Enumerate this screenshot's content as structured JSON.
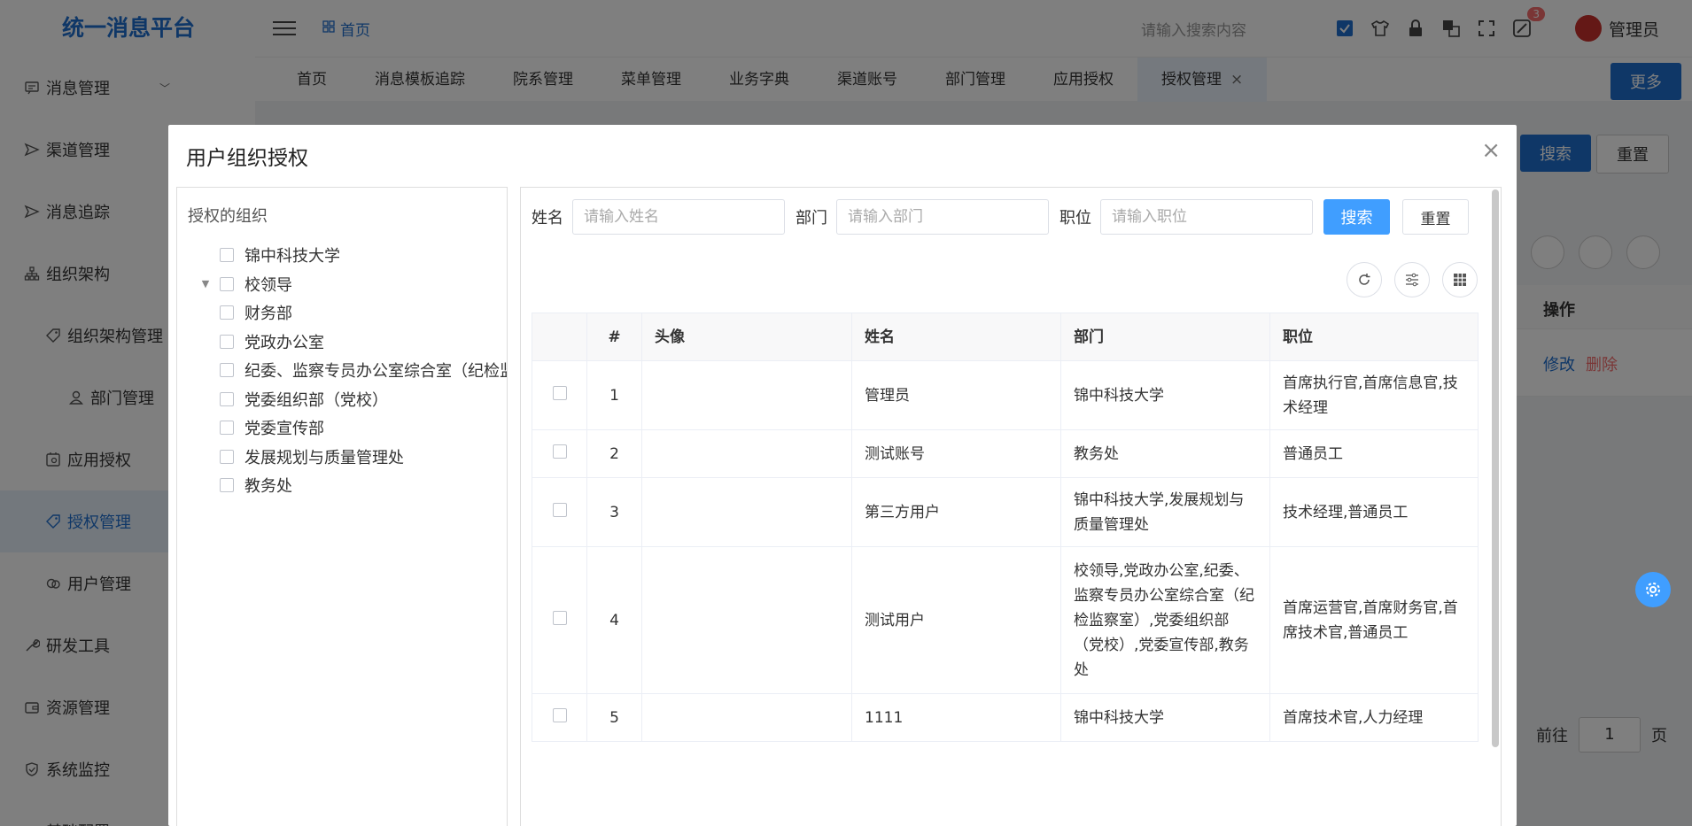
{
  "app": {
    "title": "统一消息平台"
  },
  "sidebar": {
    "items": [
      {
        "label": "消息管理",
        "icon": "message-icon",
        "level": 0,
        "arrow": true
      },
      {
        "label": "渠道管理",
        "icon": "send-icon",
        "level": 0
      },
      {
        "label": "消息追踪",
        "icon": "send-icon",
        "level": 0
      },
      {
        "label": "组织架构",
        "icon": "org-tree-icon",
        "level": 0
      },
      {
        "label": "组织架构管理",
        "icon": "tag-icon",
        "level": 1
      },
      {
        "label": "部门管理",
        "icon": "user-icon",
        "level": 2
      },
      {
        "label": "应用授权",
        "icon": "app-icon",
        "level": 1
      },
      {
        "label": "授权管理",
        "icon": "tag-icon",
        "level": 1,
        "active": true
      },
      {
        "label": "用户管理",
        "icon": "users-icon",
        "level": 1
      },
      {
        "label": "研发工具",
        "icon": "wrench-icon",
        "level": 0
      },
      {
        "label": "资源管理",
        "icon": "wallet-icon",
        "level": 0
      },
      {
        "label": "系统监控",
        "icon": "shield-icon",
        "level": 0
      },
      {
        "label": "基础配置",
        "icon": "users-icon",
        "level": 0
      }
    ]
  },
  "topbar": {
    "breadcrumb": "首页",
    "search_placeholder": "请输入搜索内容",
    "notification_count": "3",
    "user_name": "管理员"
  },
  "tabs": [
    {
      "label": "首页"
    },
    {
      "label": "消息模板追踪"
    },
    {
      "label": "院系管理"
    },
    {
      "label": "菜单管理"
    },
    {
      "label": "业务字典"
    },
    {
      "label": "渠道账号"
    },
    {
      "label": "部门管理"
    },
    {
      "label": "应用授权"
    },
    {
      "label": "授权管理",
      "active": true,
      "closable": true
    }
  ],
  "more_label": "更多",
  "background": {
    "search_label": "搜索",
    "reset_label": "重置",
    "ops_header": "操作",
    "edit_label": "修改",
    "delete_label": "删除",
    "goto_label": "前往",
    "page_value": "1",
    "page_suffix": "页"
  },
  "dialog": {
    "title": "用户组织授权",
    "org_panel_title": "授权的组织",
    "tree": [
      {
        "label": "锦中科技大学",
        "level": 0
      },
      {
        "label": "校领导",
        "level": 0,
        "expanded": true
      },
      {
        "label": "财务部",
        "level": 1
      },
      {
        "label": "党政办公室",
        "level": 0
      },
      {
        "label": "纪委、监察专员办公室综合室（纪检监察室）",
        "level": 0
      },
      {
        "label": "党委组织部（党校）",
        "level": 0
      },
      {
        "label": "党委宣传部",
        "level": 0
      },
      {
        "label": "发展规划与质量管理处",
        "level": 0
      },
      {
        "label": "教务处",
        "level": 0
      }
    ],
    "filter": {
      "name_label": "姓名",
      "name_placeholder": "请输入姓名",
      "dept_label": "部门",
      "dept_placeholder": "请输入部门",
      "position_label": "职位",
      "position_placeholder": "请输入职位",
      "search_label": "搜索",
      "reset_label": "重置"
    },
    "table": {
      "headers": {
        "index": "#",
        "avatar": "头像",
        "name": "姓名",
        "dept": "部门",
        "position": "职位"
      },
      "rows": [
        {
          "index": "1",
          "name": "管理员",
          "dept": "锦中科技大学",
          "position": "首席执行官,首席信息官,技术经理"
        },
        {
          "index": "2",
          "name": "测试账号",
          "dept": "教务处",
          "position": "普通员工"
        },
        {
          "index": "3",
          "name": "第三方用户",
          "dept": "锦中科技大学,发展规划与质量管理处",
          "position": "技术经理,普通员工"
        },
        {
          "index": "4",
          "name": "测试用户",
          "dept": "校领导,党政办公室,纪委、监察专员办公室综合室（纪检监察室）,党委组织部（党校）,党委宣传部,教务处",
          "position": "首席运营官,首席财务官,首席技术官,普通员工"
        },
        {
          "index": "5",
          "name": "1111",
          "dept": "锦中科技大学",
          "position": "首席技术官,人力经理"
        }
      ]
    }
  },
  "colors": {
    "primary": "#409eff",
    "brand": "#1f6fcf",
    "danger": "#f56c6c"
  }
}
